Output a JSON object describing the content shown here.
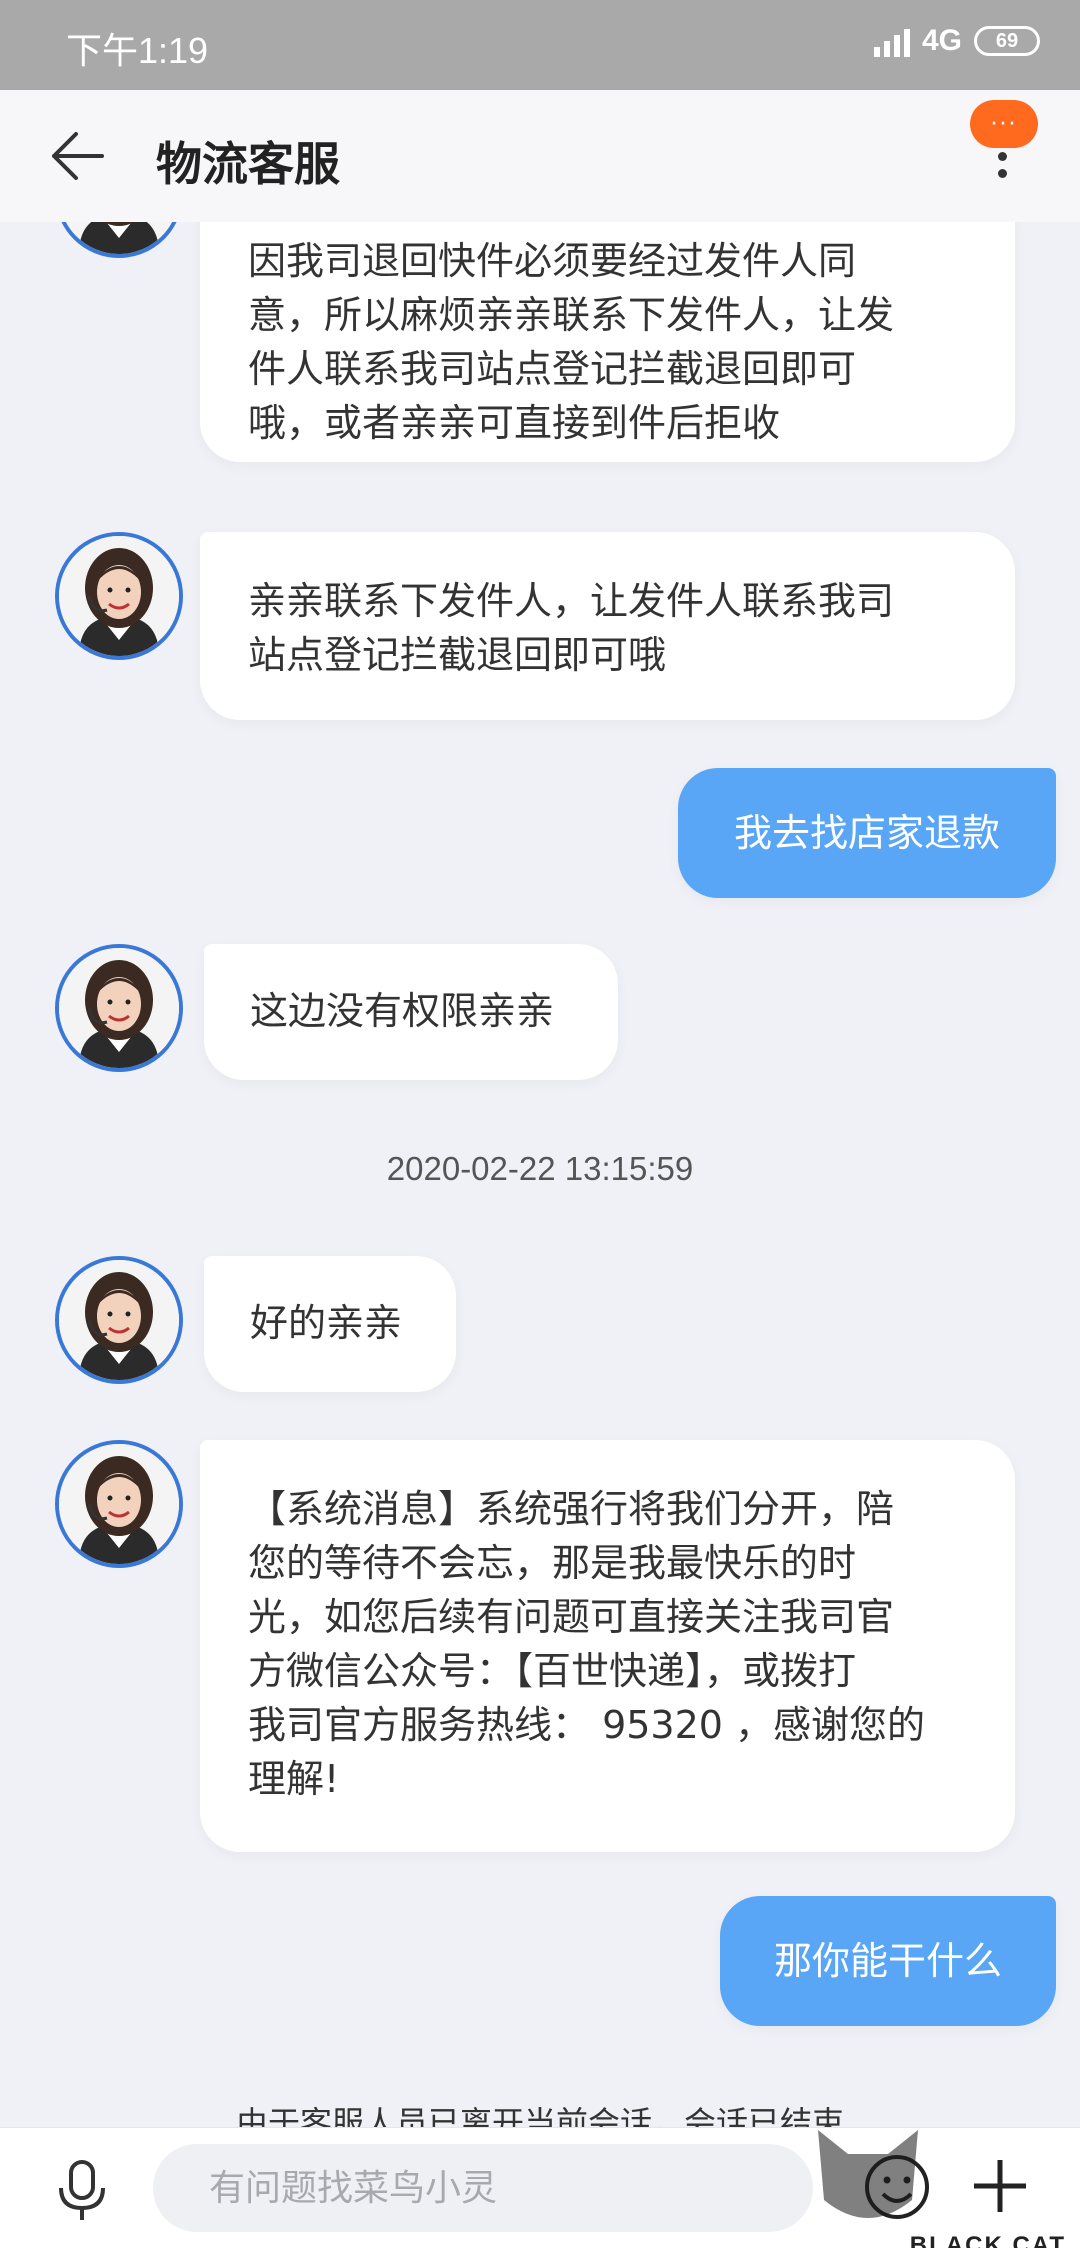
{
  "status_bar": {
    "time": "下午1:19",
    "network": "4G",
    "battery": "69"
  },
  "header": {
    "title": "物流客服",
    "badge": "···"
  },
  "messages": [
    {
      "side": "left",
      "lines": [
        "因我司退回快件必须要经过发件人同",
        "意，所以麻烦亲亲联系下发件人，让发",
        "件人联系我司站点登记拦截退回即可",
        "哦，或者亲亲可直接到件后拒收"
      ]
    },
    {
      "side": "left",
      "lines": [
        "亲亲联系下发件人，让发件人联系我司",
        "站点登记拦截退回即可哦"
      ]
    },
    {
      "side": "right",
      "lines": [
        "我去找店家退款"
      ]
    },
    {
      "side": "left",
      "lines": [
        "这边没有权限亲亲"
      ]
    },
    {
      "side": "left",
      "lines": [
        "好的亲亲"
      ]
    },
    {
      "side": "left",
      "lines": [
        "【系统消息】系统强行将我们分开，陪",
        "您的等待不会忘，那是我最快乐的时",
        "光，如您后续有问题可直接关注我司官",
        "方微信公众号：【百世快递】，或拨打",
        "我司官方服务热线： 95320 ，感谢您的",
        "理解!"
      ]
    },
    {
      "side": "right",
      "lines": [
        "那你能干什么"
      ]
    }
  ],
  "timestamp": "2020-02-22 13:15:59",
  "system_note": "由于客服人员已离开当前会话，会话已结束",
  "input": {
    "placeholder": "有问题找菜鸟小灵"
  },
  "watermark": {
    "text": "BLACK CAT"
  },
  "colors": {
    "accent": "#5aa6f6",
    "badge": "#ff6a1f",
    "avatar_border": "#3a78d8"
  }
}
